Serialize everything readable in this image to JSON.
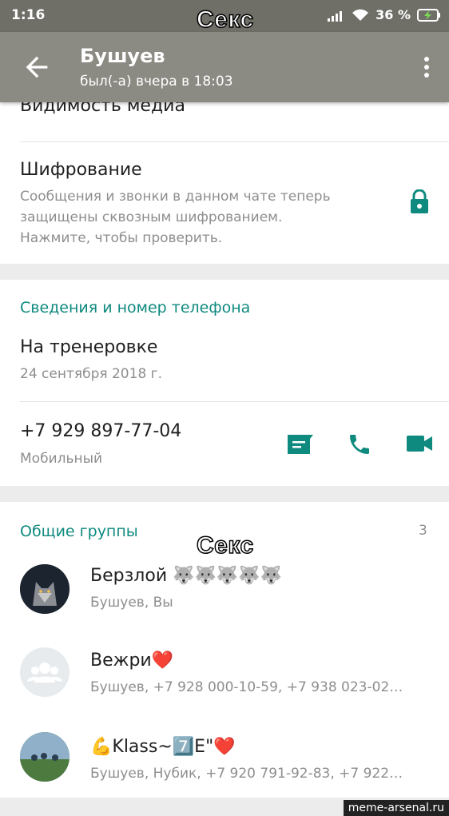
{
  "status_bar": {
    "time": "1:16",
    "battery": "36 %"
  },
  "captions": {
    "top": "Секс",
    "middle": "Секс"
  },
  "app_bar": {
    "contact_name": "Бушуев",
    "last_seen": "был(-а) вчера в 18:03"
  },
  "media_visibility": {
    "label": "Видимость медиа"
  },
  "encryption": {
    "title": "Шифрование",
    "line1": "Сообщения и звонки в данном чате теперь",
    "line2": "защищены сквозным шифрованием.",
    "line3": "Нажмите, чтобы проверить."
  },
  "about": {
    "section_title": "Сведения и номер телефона",
    "status": "На тренеровке",
    "status_date": "24 сентября 2018 г.",
    "phone": "+7 929 897-77-04",
    "phone_type": "Мобильный"
  },
  "groups": {
    "section_title": "Общие группы",
    "count": "3",
    "items": [
      {
        "name": "Берзлой 🐺🐺🐺🐺🐺",
        "members": "Бушуев, Вы"
      },
      {
        "name": "Вежри❤️",
        "members": "Бушуев, +7 928 000-10-59, +7 938 023-02…"
      },
      {
        "name": "💪Klass~7️⃣E\"❤️",
        "members": "Бушуев, Нубик, +7 920 791-92-83, +7 922…"
      }
    ]
  },
  "watermark": "meme-arsenal.ru",
  "colors": {
    "accent": "#0f8a7f",
    "app_bar": "#8b8a83",
    "status_bar": "#6f6f68"
  }
}
